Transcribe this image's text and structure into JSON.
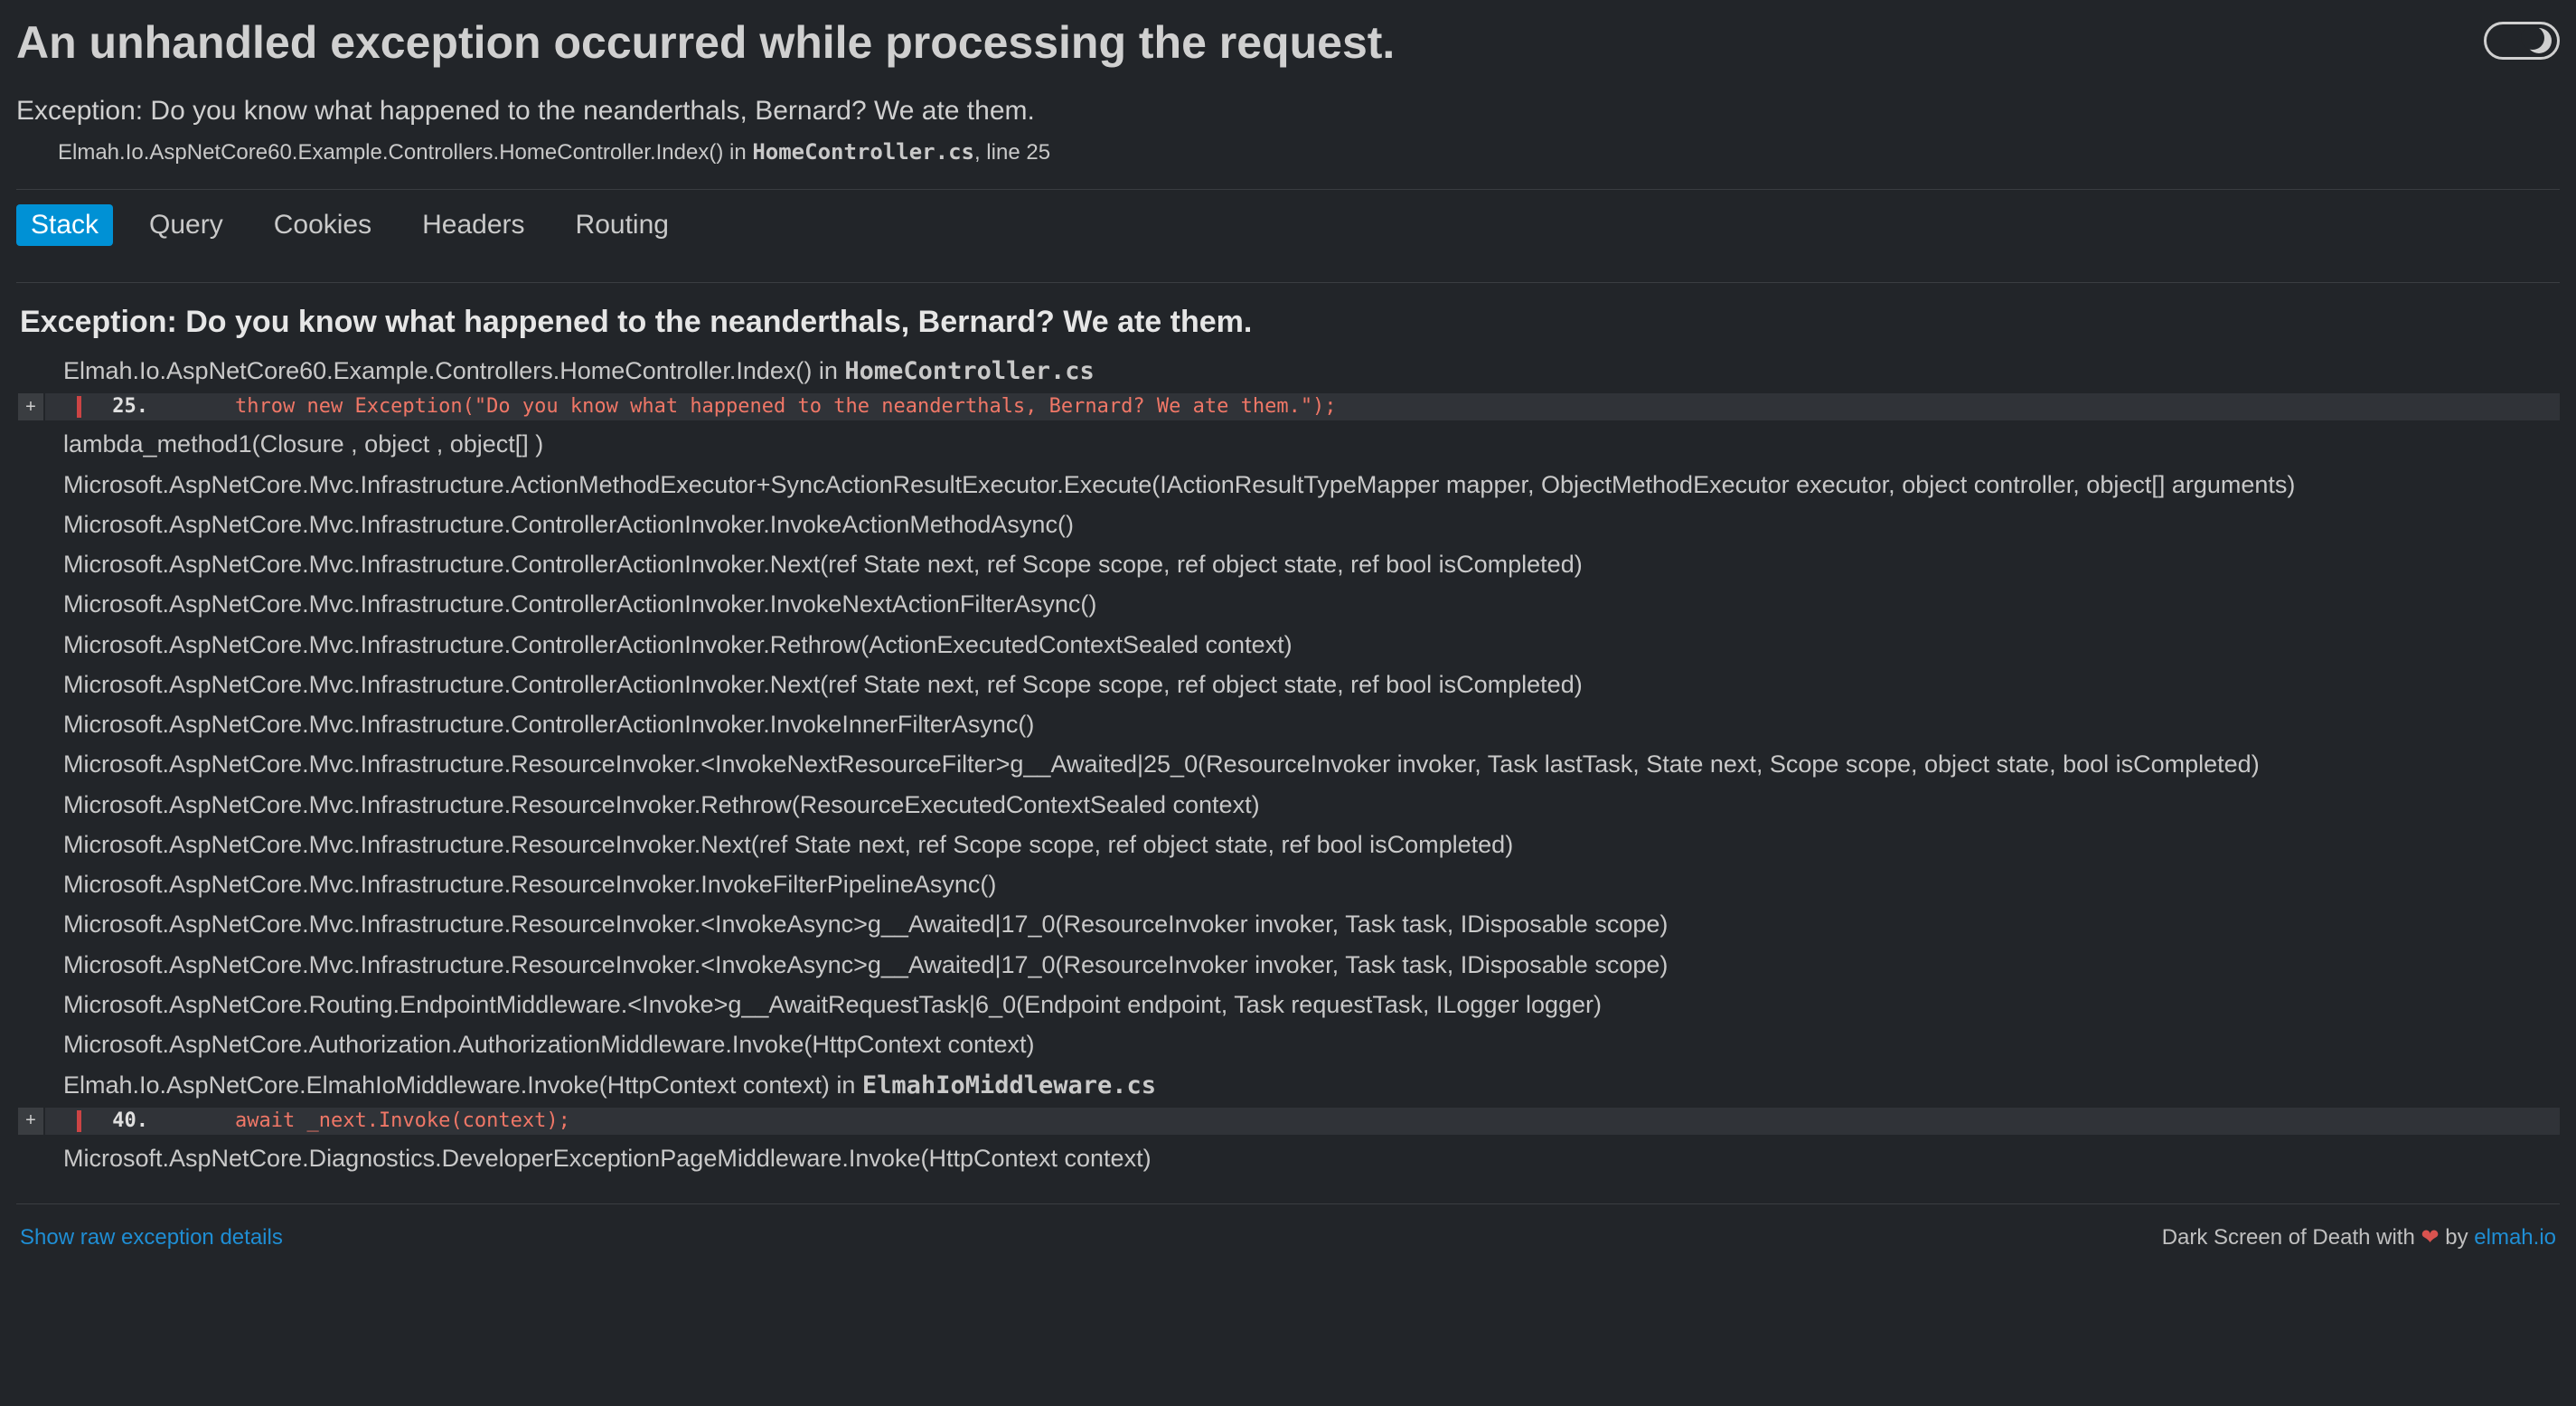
{
  "header": {
    "title": "An unhandled exception occurred while processing the request.",
    "subtitle": "Exception: Do you know what happened to the neanderthals, Bernard? We ate them.",
    "origin": {
      "method": "Elmah.Io.AspNetCore60.Example.Controllers.HomeController.Index() in ",
      "file": "HomeController.cs",
      "line_prefix": ", line ",
      "line_no": "25"
    }
  },
  "tabs": {
    "stack": "Stack",
    "query": "Query",
    "cookies": "Cookies",
    "headers": "Headers",
    "routing": "Routing",
    "active": "stack"
  },
  "section_heading": "Exception: Do you know what happened to the neanderthals, Bernard? We ate them.",
  "frames": [
    {
      "type": "frame_with_file",
      "text_pre": "Elmah.Io.AspNetCore60.Example.Controllers.HomeController.Index() in ",
      "file": "HomeController.cs"
    },
    {
      "type": "src",
      "line_no": "25.",
      "code": "throw new Exception(\"Do you know what happened to the neanderthals, Bernard? We ate them.\");"
    },
    {
      "type": "frame",
      "text": "lambda_method1(Closure , object , object[] )"
    },
    {
      "type": "frame",
      "text": "Microsoft.AspNetCore.Mvc.Infrastructure.ActionMethodExecutor+SyncActionResultExecutor.Execute(IActionResultTypeMapper mapper, ObjectMethodExecutor executor, object controller, object[] arguments)"
    },
    {
      "type": "frame",
      "text": "Microsoft.AspNetCore.Mvc.Infrastructure.ControllerActionInvoker.InvokeActionMethodAsync()"
    },
    {
      "type": "frame",
      "text": "Microsoft.AspNetCore.Mvc.Infrastructure.ControllerActionInvoker.Next(ref State next, ref Scope scope, ref object state, ref bool isCompleted)"
    },
    {
      "type": "frame",
      "text": "Microsoft.AspNetCore.Mvc.Infrastructure.ControllerActionInvoker.InvokeNextActionFilterAsync()"
    },
    {
      "type": "frame",
      "text": "Microsoft.AspNetCore.Mvc.Infrastructure.ControllerActionInvoker.Rethrow(ActionExecutedContextSealed context)"
    },
    {
      "type": "frame",
      "text": "Microsoft.AspNetCore.Mvc.Infrastructure.ControllerActionInvoker.Next(ref State next, ref Scope scope, ref object state, ref bool isCompleted)"
    },
    {
      "type": "frame",
      "text": "Microsoft.AspNetCore.Mvc.Infrastructure.ControllerActionInvoker.InvokeInnerFilterAsync()"
    },
    {
      "type": "frame",
      "text": "Microsoft.AspNetCore.Mvc.Infrastructure.ResourceInvoker.<InvokeNextResourceFilter>g__Awaited|25_0(ResourceInvoker invoker, Task lastTask, State next, Scope scope, object state, bool isCompleted)"
    },
    {
      "type": "frame",
      "text": "Microsoft.AspNetCore.Mvc.Infrastructure.ResourceInvoker.Rethrow(ResourceExecutedContextSealed context)"
    },
    {
      "type": "frame",
      "text": "Microsoft.AspNetCore.Mvc.Infrastructure.ResourceInvoker.Next(ref State next, ref Scope scope, ref object state, ref bool isCompleted)"
    },
    {
      "type": "frame",
      "text": "Microsoft.AspNetCore.Mvc.Infrastructure.ResourceInvoker.InvokeFilterPipelineAsync()"
    },
    {
      "type": "frame",
      "text": "Microsoft.AspNetCore.Mvc.Infrastructure.ResourceInvoker.<InvokeAsync>g__Awaited|17_0(ResourceInvoker invoker, Task task, IDisposable scope)"
    },
    {
      "type": "frame",
      "text": "Microsoft.AspNetCore.Mvc.Infrastructure.ResourceInvoker.<InvokeAsync>g__Awaited|17_0(ResourceInvoker invoker, Task task, IDisposable scope)"
    },
    {
      "type": "frame",
      "text": "Microsoft.AspNetCore.Routing.EndpointMiddleware.<Invoke>g__AwaitRequestTask|6_0(Endpoint endpoint, Task requestTask, ILogger logger)"
    },
    {
      "type": "frame",
      "text": "Microsoft.AspNetCore.Authorization.AuthorizationMiddleware.Invoke(HttpContext context)"
    },
    {
      "type": "frame_with_file",
      "text_pre": "Elmah.Io.AspNetCore.ElmahIoMiddleware.Invoke(HttpContext context) in ",
      "file": "ElmahIoMiddleware.cs"
    },
    {
      "type": "src",
      "line_no": "40.",
      "code": "await _next.Invoke(context);"
    },
    {
      "type": "frame",
      "text": "Microsoft.AspNetCore.Diagnostics.DeveloperExceptionPageMiddleware.Invoke(HttpContext context)"
    }
  ],
  "footer": {
    "raw_link": "Show raw exception details",
    "credit_pre": "Dark Screen of Death with ",
    "credit_mid": " by ",
    "credit_link": "elmah.io"
  }
}
